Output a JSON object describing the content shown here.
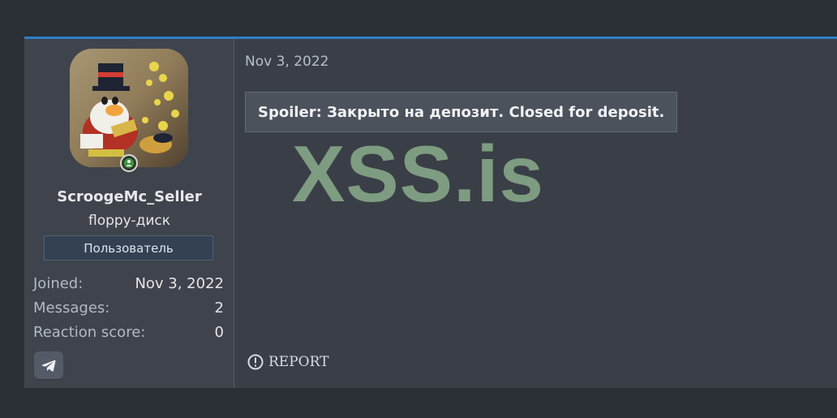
{
  "post": {
    "date": "Nov 3, 2022",
    "spoiler_label": "Spoiler: Закрыто на депозит. Closed for deposit.",
    "watermark": "XSS.is",
    "report_label": "REPORT"
  },
  "user": {
    "name": "ScroogeMc_Seller",
    "title": "floppy-диск",
    "role": "Пользователь",
    "stats": [
      {
        "label": "Joined:",
        "value": "Nov 3, 2022"
      },
      {
        "label": "Messages:",
        "value": "2"
      },
      {
        "label": "Reaction score:",
        "value": "0"
      }
    ],
    "status": "online"
  },
  "icons": {
    "telegram": "telegram-icon",
    "report": "report-icon",
    "online": "online-indicator-icon"
  },
  "colors": {
    "accent": "#2f7ec9",
    "watermark": "#7e9c81",
    "background": "#2b2f36"
  }
}
